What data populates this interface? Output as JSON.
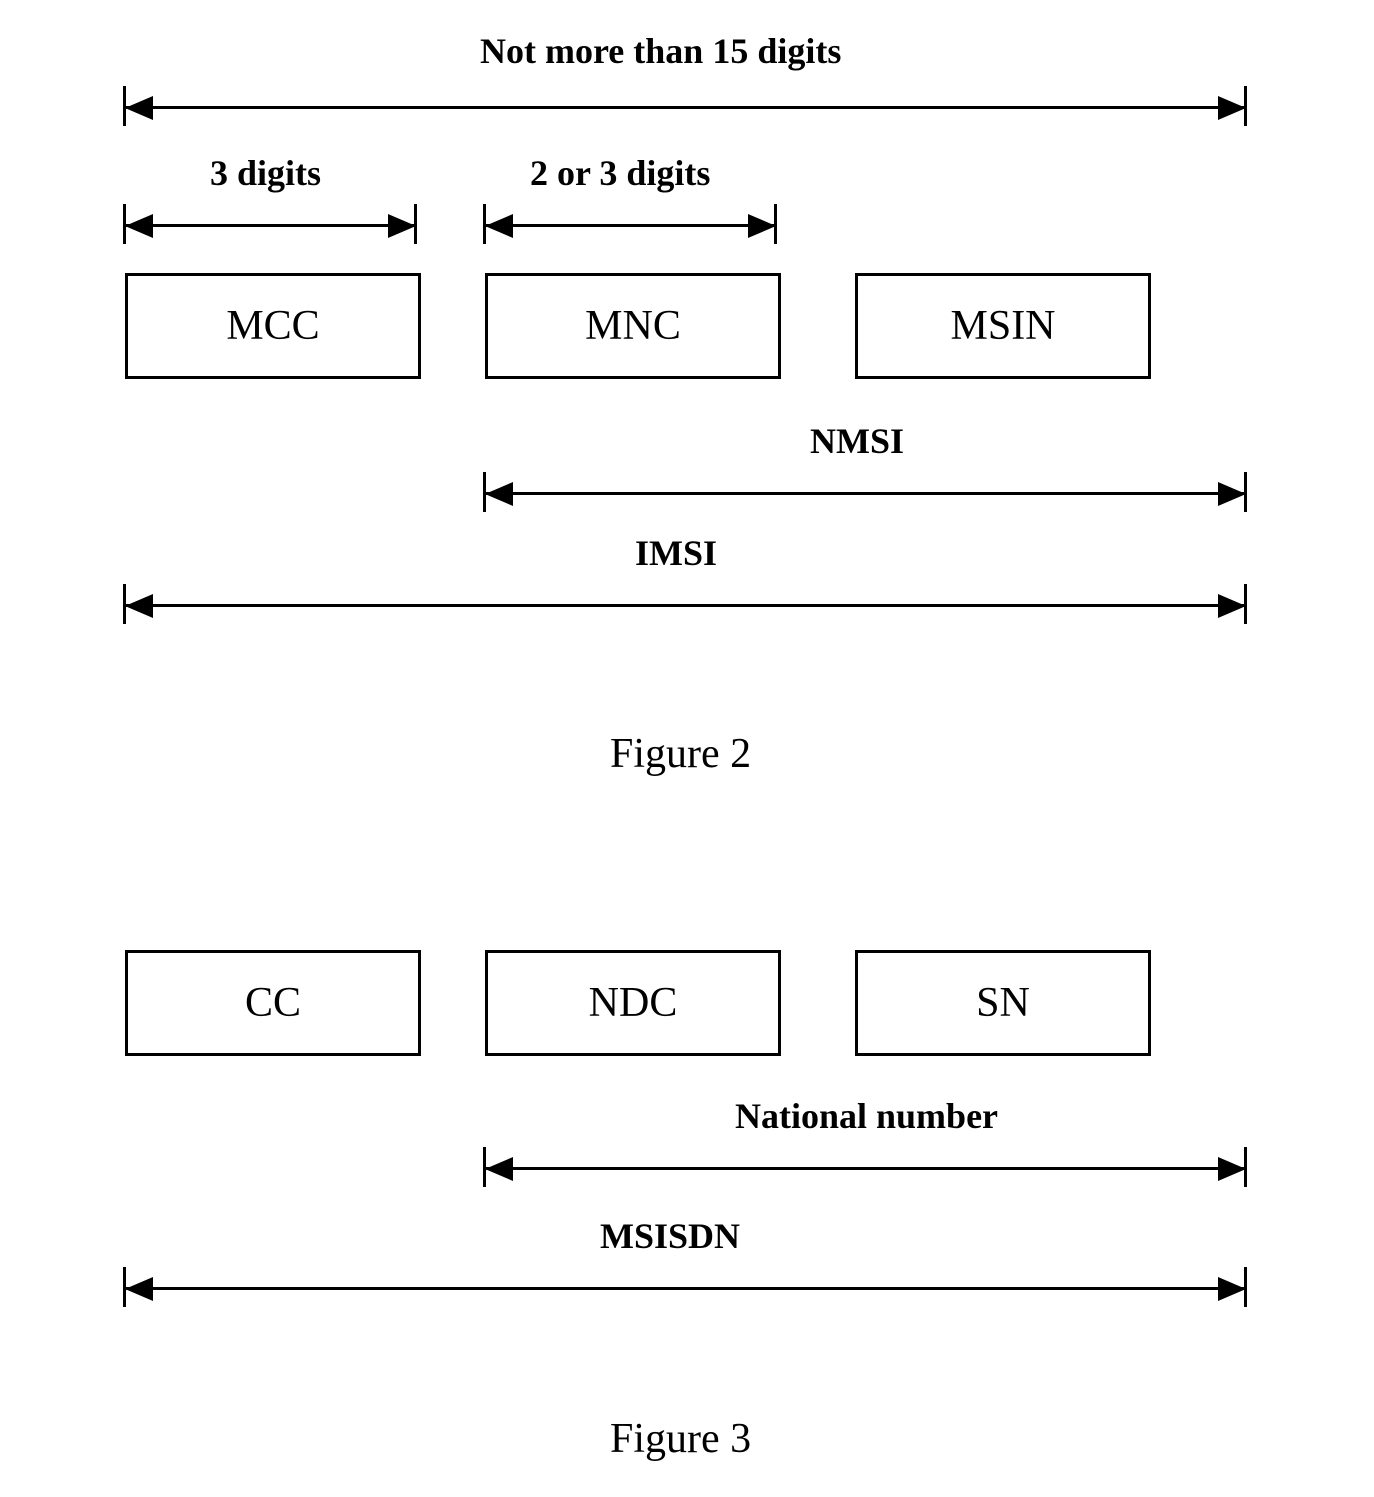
{
  "fig2": {
    "caption": "Figure 2",
    "top_label": "Not more than 15 digits",
    "dim_mcc": "3 digits",
    "dim_mnc": "2 or 3 digits",
    "boxes": {
      "mcc": "MCC",
      "mnc": "MNC",
      "msin": "MSIN"
    },
    "nmsi": "NMSI",
    "imsi": "IMSI"
  },
  "fig3": {
    "caption": "Figure 3",
    "boxes": {
      "cc": "CC",
      "ndc": "NDC",
      "sn": "SN"
    },
    "national": "National number",
    "msisdn": "MSISDN"
  }
}
